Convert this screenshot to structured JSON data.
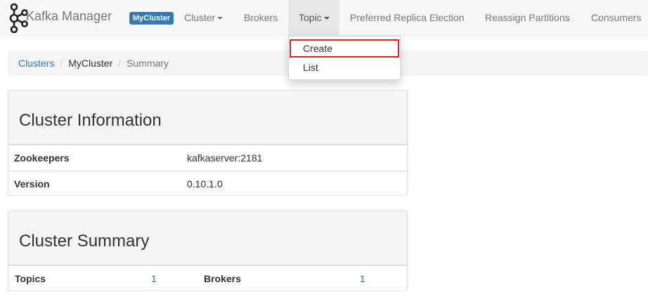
{
  "navbar": {
    "brand": "Kafka Manager",
    "cluster_badge": "MyCluster",
    "items": [
      {
        "label": "Cluster"
      },
      {
        "label": "Brokers"
      },
      {
        "label": "Topic"
      },
      {
        "label": "Preferred Replica Election"
      },
      {
        "label": "Reassign Partitions"
      },
      {
        "label": "Consumers"
      }
    ]
  },
  "topic_menu": {
    "items": [
      {
        "label": "Create"
      },
      {
        "label": "List"
      }
    ]
  },
  "breadcrumb": {
    "items": [
      "Clusters",
      "MyCluster",
      "Summary"
    ],
    "separator": "/"
  },
  "cluster_information": {
    "title": "Cluster Information",
    "rows": [
      {
        "label": "Zookeepers",
        "value": "kafkaserver:2181"
      },
      {
        "label": "Version",
        "value": "0.10.1.0"
      }
    ]
  },
  "cluster_summary": {
    "title": "Cluster Summary",
    "topics_label": "Topics",
    "topics_value": "1",
    "brokers_label": "Brokers",
    "brokers_value": "1"
  },
  "colors": {
    "link": "#337ab7",
    "highlight_border": "#e02020",
    "navbar_bg": "#f8f8f8"
  }
}
